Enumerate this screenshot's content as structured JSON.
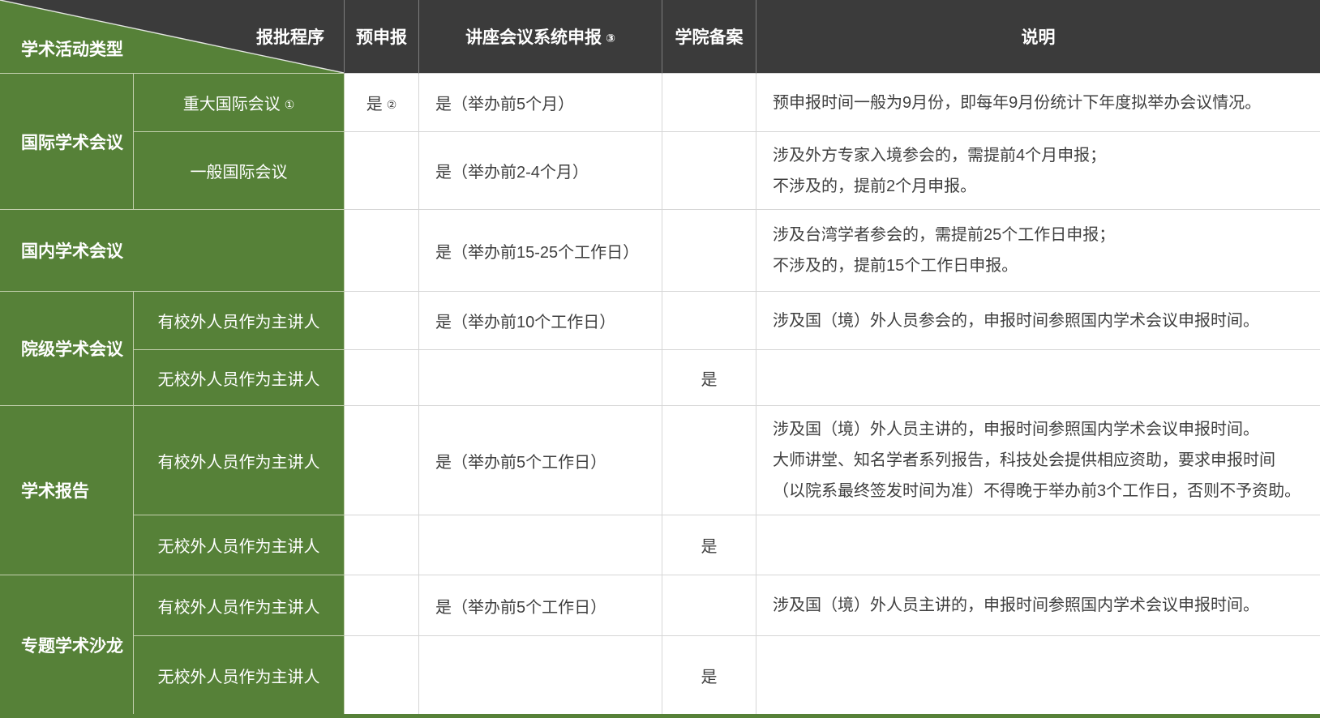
{
  "colors": {
    "green": "#568138",
    "header_dark": "#3b3b3b",
    "grid_white_cells": "#d6d6d6",
    "grid_green_cells": "#c3d0ae",
    "text_dark": "#3f3f3f",
    "text_light": "#ffffff"
  },
  "header": {
    "corner_top_right": "报批程序",
    "corner_bottom_left": "学术活动类型",
    "pre_declare": "预申报",
    "system_declare": "讲座会议系统申报",
    "system_declare_note": "③",
    "college_record": "学院备案",
    "description": "说明"
  },
  "groups": [
    {
      "category": "国际学术会议",
      "rows": [
        {
          "sub": "重大国际会议",
          "sub_note": "①",
          "pre": "是",
          "pre_note": "②",
          "system": "是（举办前5个月）",
          "college": "",
          "desc": [
            "预申报时间一般为9月份，即每年9月份统计下年度拟举办会议情况。"
          ]
        },
        {
          "sub": "一般国际会议",
          "pre": "",
          "system": "是（举办前2-4个月）",
          "college": "",
          "desc": [
            "涉及外方专家入境参会的，需提前4个月申报；",
            "不涉及的，提前2个月申报。"
          ]
        }
      ]
    },
    {
      "category": "国内学术会议",
      "rows": [
        {
          "pre": "",
          "system": "是（举办前15-25个工作日）",
          "college": "",
          "desc": [
            "涉及台湾学者参会的，需提前25个工作日申报；",
            "不涉及的，提前15个工作日申报。"
          ]
        }
      ]
    },
    {
      "category": "院级学术会议",
      "rows": [
        {
          "sub": "有校外人员作为主讲人",
          "pre": "",
          "system": "是（举办前10个工作日）",
          "college": "",
          "desc": [
            "涉及国（境）外人员参会的，申报时间参照国内学术会议申报时间。"
          ]
        },
        {
          "sub": "无校外人员作为主讲人",
          "pre": "",
          "system": "",
          "college": "是",
          "desc": []
        }
      ]
    },
    {
      "category": "学术报告",
      "rows": [
        {
          "sub": "有校外人员作为主讲人",
          "pre": "",
          "system": "是（举办前5个工作日）",
          "college": "",
          "desc": [
            "涉及国（境）外人员主讲的，申报时间参照国内学术会议申报时间。",
            "大师讲堂、知名学者系列报告，科技处会提供相应资助，要求申报时间（以院系最终签发时间为准）不得晚于举办前3个工作日，否则不予资助。"
          ]
        },
        {
          "sub": "无校外人员作为主讲人",
          "pre": "",
          "system": "",
          "college": "是",
          "desc": []
        }
      ]
    },
    {
      "category": "专题学术沙龙",
      "rows": [
        {
          "sub": "有校外人员作为主讲人",
          "pre": "",
          "system": "是（举办前5个工作日）",
          "college": "",
          "desc": [
            "涉及国（境）外人员主讲的，申报时间参照国内学术会议申报时间。"
          ]
        },
        {
          "sub": "无校外人员作为主讲人",
          "pre": "",
          "system": "",
          "college": "是",
          "desc": []
        }
      ]
    }
  ]
}
